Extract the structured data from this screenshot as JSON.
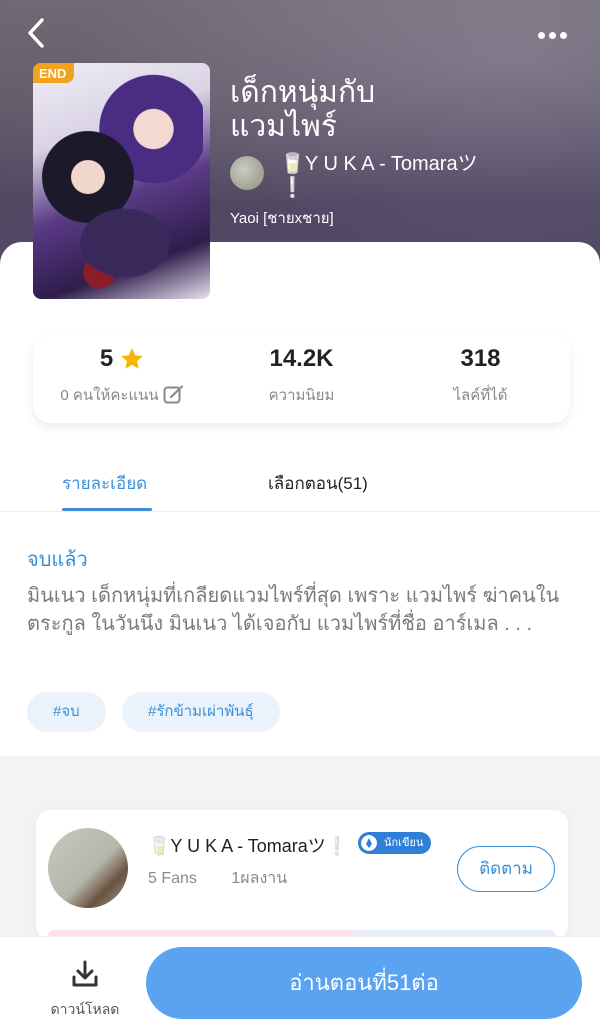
{
  "hero": {
    "badge": "END",
    "title": "เด็กหนุ่มกับแวมไพร์",
    "author": "🥛Y U K A - Tomaraツ❕",
    "genre": "Yaoi [ชายxชาย]"
  },
  "stats": {
    "rating_value": "5",
    "rating_label": "0 คนให้คะแนน",
    "popularity_value": "14.2K",
    "popularity_label": "ความนิยม",
    "likes_value": "318",
    "likes_label": "ไลค์ที่ได้"
  },
  "tabs": {
    "detail": "รายละเอียด",
    "chapters": "เลือกตอน(51)"
  },
  "detail": {
    "status": "จบแล้ว",
    "synopsis": "มินเนว เด็กหนุ่มที่เกลียดแวมไพร์ที่สุด เพราะ แวมไพร์ ฆ่าคนในตระกูล ในวันนึง มินเนว ได้เจอกับ แวมไพร์ที่ชื่อ อาร์เมล . . .",
    "tags": [
      "#จบ",
      "#รักข้ามเผ่าพันธุ์"
    ]
  },
  "author_card": {
    "name": "🥛Y U K A - Tomaraツ❕",
    "badge": "นักเขียน",
    "fans": "5 Fans",
    "works": "1ผลงาน",
    "follow": "ติดตาม"
  },
  "bottom": {
    "download": "ดาวน์โหลด",
    "read": "อ่านตอนที่51ต่อ"
  },
  "colors": {
    "accent": "#3d8fd6",
    "read_button": "#5aa3f0",
    "end_badge": "#f4a11c",
    "star": "#f7b500"
  },
  "icons": [
    "back-icon",
    "more-icon",
    "star-icon",
    "edit-icon",
    "writer-icon",
    "download-icon"
  ]
}
